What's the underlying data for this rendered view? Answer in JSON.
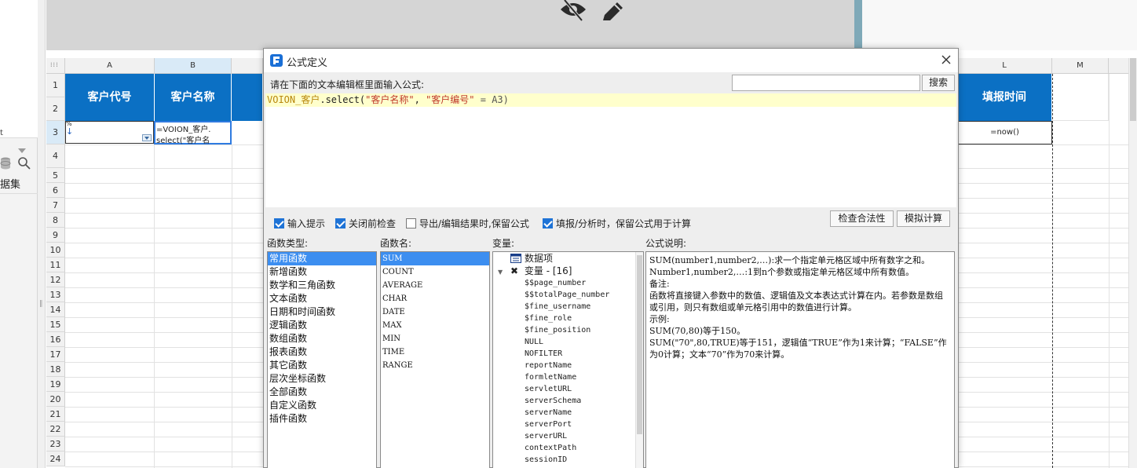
{
  "left_panel": {
    "partial_text": "t",
    "dataset_label": "据集"
  },
  "sheet": {
    "columns": [
      "A",
      "B",
      "L",
      "M"
    ],
    "rows": [
      "1",
      "2",
      "3",
      "4",
      "5",
      "6",
      "7",
      "8",
      "9",
      "10",
      "11",
      "12",
      "13",
      "14",
      "15",
      "16",
      "17",
      "18",
      "19",
      "20",
      "21",
      "22",
      "23",
      "24"
    ],
    "header_cells": {
      "a": "客户代号",
      "b": "客户名称",
      "l": "填报时间"
    },
    "cells": {
      "a3_mark": "%",
      "a3_arrow": "↓",
      "b3_line1": "=VOION_客户.",
      "b3_line2": "select(\"客户名",
      "l3": "=now()"
    }
  },
  "dialog": {
    "title": "公式定义",
    "prompt": "请在下面的文本编辑框里面输入公式:",
    "search_value": "",
    "search_button": "搜索",
    "formula": {
      "obj": "VOION_客户",
      "method": ".select(",
      "arg1": "\"客户名称\"",
      "sep": ", ",
      "arg2": "\"客户编号\"",
      "rest": " = A3)"
    },
    "options": [
      {
        "label": "输入提示",
        "checked": true
      },
      {
        "label": "关闭前检查",
        "checked": true
      },
      {
        "label": "导出/编辑结果时,保留公式",
        "checked": false
      },
      {
        "label": "填报/分析时，保留公式用于计算",
        "checked": true
      }
    ],
    "buttons": {
      "check": "检查合法性",
      "simulate": "模拟计算"
    },
    "labels": {
      "func_types": "函数类型:",
      "func_names": "函数名:",
      "variables": "变量:",
      "desc": "公式说明:"
    },
    "func_types": [
      "常用函数",
      "新增函数",
      "数学和三角函数",
      "文本函数",
      "日期和时间函数",
      "逻辑函数",
      "数组函数",
      "报表函数",
      "其它函数",
      "层次坐标函数",
      "全部函数",
      "自定义函数",
      "插件函数"
    ],
    "func_names": [
      "SUM",
      "COUNT",
      "AVERAGE",
      "CHAR",
      "DATE",
      "MAX",
      "MIN",
      "TIME",
      "RANGE"
    ],
    "variables": {
      "dataset_node": "数据项",
      "var_node": "变量 - [16]",
      "items": [
        "$$page_number",
        "$$totalPage_number",
        "$fine_username",
        "$fine_role",
        "$fine_position",
        "NULL",
        "NOFILTER",
        "reportName",
        "formletName",
        "servletURL",
        "serverSchema",
        "serverName",
        "serverPort",
        "serverURL",
        "contextPath",
        "sessionID"
      ]
    },
    "description": [
      "SUM(number1,number2,…):求一个指定单元格区域中所有数字之和。",
      "Number1,number2,…:1到n个参数或指定单元格区域中所有数值。",
      "备注:",
      "函数将直接键入参数中的数值、逻辑值及文本表达式计算在内。若参数是数组或引用，则只有数组或单元格引用中的数值进行计算。",
      "示例:",
      "SUM(70,80)等于150。",
      "SUM(\"70\",80,TRUE)等于151，逻辑值“TRUE”作为1来计算；“FALSE”作为0计算；文本“70”作为70来计算。"
    ]
  },
  "colors": {
    "header_blue": "#0b70c4",
    "selection_blue": "#3c8ef0",
    "formula_bg": "#ffffcc"
  }
}
